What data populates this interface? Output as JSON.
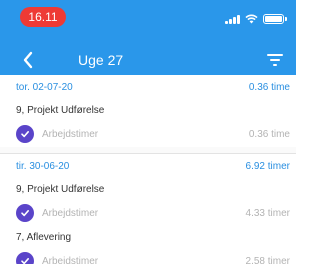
{
  "status_bar": {
    "time": "16.11"
  },
  "header": {
    "title": "Uge 27"
  },
  "days": [
    {
      "date": "tor. 02-07-20",
      "total": "0.36 time",
      "projects": [
        {
          "name": "9, Projekt Udførelse",
          "entries": [
            {
              "label": "Arbejdstimer",
              "hours": "0.36 time"
            }
          ]
        }
      ]
    },
    {
      "date": "tir. 30-06-20",
      "total": "6.92 timer",
      "projects": [
        {
          "name": "9, Projekt Udførelse",
          "entries": [
            {
              "label": "Arbejdstimer",
              "hours": "4.33 timer"
            }
          ]
        },
        {
          "name": "7, Aflevering",
          "entries": [
            {
              "label": "Arbejdstimer",
              "hours": "2.58 timer"
            }
          ]
        }
      ]
    }
  ],
  "colors": {
    "header_blue": "#2a97ea",
    "status_red": "#ee3a35",
    "check_purple": "#5a44c9",
    "date_blue": "#2a8fe0"
  },
  "icons": {
    "back": "chevron-left-icon",
    "filter": "filter-icon",
    "check": "check-circle-icon"
  }
}
